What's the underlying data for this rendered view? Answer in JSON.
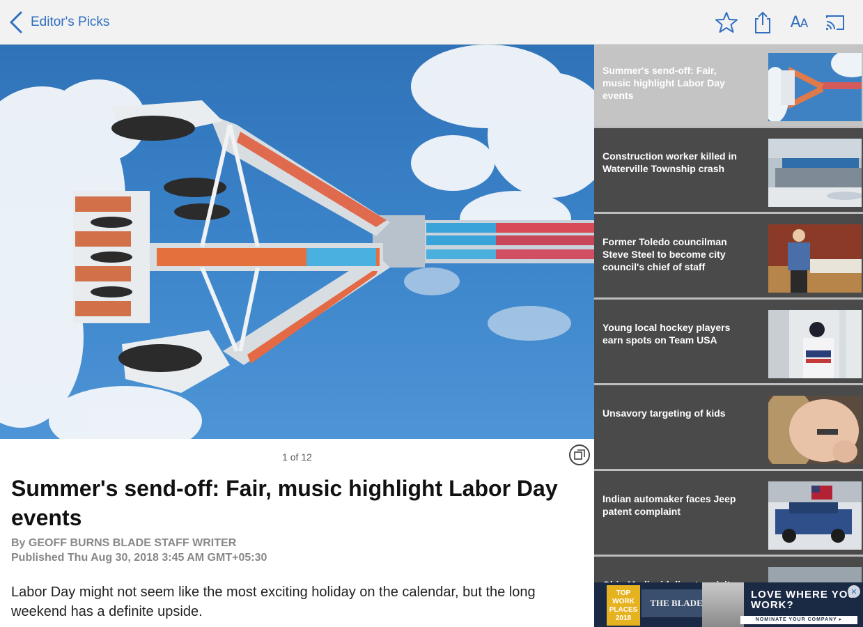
{
  "nav": {
    "back_label": "Editor's Picks",
    "icons": [
      "star-icon",
      "share-icon",
      "text-size-icon",
      "cast-icon"
    ],
    "text_size_label_big": "A",
    "text_size_label_small": "A"
  },
  "article": {
    "photo_counter": "1 of 12",
    "headline": "Summer's send-off: Fair, music highlight Labor Day events",
    "byline": "By GEOFF BURNS BLADE STAFF WRITER",
    "published": "Published Thu Aug 30, 2018 3:45 AM GMT+05:30",
    "body": "Labor Day might not seem like the most exciting holiday on the calendar, but the long weekend has a definite upside."
  },
  "sidebar": {
    "items": [
      {
        "title": "Summer's send-off: Fair, music highlight Labor Day events",
        "active": true
      },
      {
        "title": "Construction worker killed in Waterville Township crash",
        "active": false
      },
      {
        "title": "Former Toledo councilman Steve Steel to become city council's chief of staff",
        "active": false
      },
      {
        "title": "Young local hockey players earn spots on Team USA",
        "active": false
      },
      {
        "title": "Unsavory targeting of kids",
        "active": false
      },
      {
        "title": "Indian automaker faces Jeep patent complaint",
        "active": false
      },
      {
        "title": "Ohio Medicaid director visits",
        "active": false
      }
    ]
  },
  "ad": {
    "badge": "TOP WORK PLACES 2018",
    "brand": "THE BLADE",
    "headline": "LOVE WHERE YOU WORK?",
    "sub": "NOMINATE YOUR COMPANY ▸",
    "close": "✕"
  },
  "colors": {
    "accent": "#2f6ec0",
    "sidebar_bg": "#4a4a4a",
    "sidebar_active": "#c4c4c4"
  }
}
